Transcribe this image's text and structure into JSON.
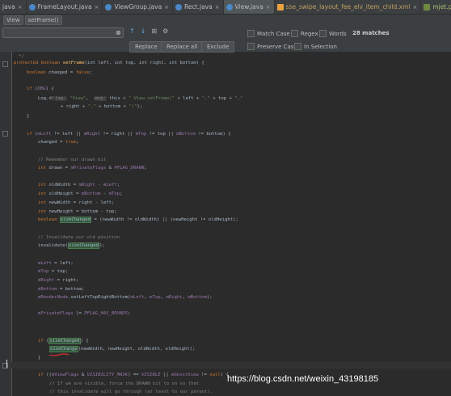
{
  "tabs": [
    {
      "label": "java",
      "icon": "java-file-icon",
      "active": false
    },
    {
      "label": "FrameLayout.java",
      "icon": "java-file-icon",
      "active": false
    },
    {
      "label": "ViewGroup.java",
      "icon": "java-file-icon",
      "active": false
    },
    {
      "label": "Rect.java",
      "icon": "java-file-icon",
      "active": false
    },
    {
      "label": "View.java",
      "icon": "java-file-icon",
      "active": true
    },
    {
      "label": "sse_swipe_layout_fee_elv_item_child.xml",
      "icon": "xml-file-icon",
      "active": false
    },
    {
      "label": "mjet.properties",
      "icon": "properties-file-icon",
      "active": false
    }
  ],
  "tab_close": "×",
  "breadcrumbs": [
    "View",
    "setFrame()"
  ],
  "find": {
    "input_value": "",
    "match_case": "Match Case",
    "regex": "Regex",
    "words": "Words",
    "matches": "28 matches",
    "preserve_case": "Preserve Case",
    "in_selection": "In Selection",
    "replace": "Replace",
    "replace_all": "Replace all",
    "exclude": "Exclude"
  },
  "code": {
    "l00": "*/",
    "l01_kw": "protected boolean ",
    "l01_mt": "setFrame",
    "l01_rest": "(int left, int top, int right, int bottom) {",
    "l02_kw": "boolean ",
    "l02_rest": "changed = ",
    "l02_kw2": "false",
    "l02_end": ";",
    "l04_kw": "if ",
    "l04_rest": "(",
    "l04_fd": "DBG",
    "l04_end": ") {",
    "l05_a": "Log.d(",
    "l05_tag": "tag:",
    "l05_s1": " \"View\"",
    "l05_c": ",  ",
    "l05_msg": "msg:",
    "l05_b": " this + ",
    "l05_s2": "\" View.setFrame(\"",
    "l05_e": " + left + ",
    "l05_s3": "\",\"",
    "l05_f": " + top + ",
    "l05_s4": "\",\"",
    "l06_a": "+ right + ",
    "l06_s": "\",\"",
    "l06_b": " + bottom + ",
    "l06_s2": "\")\"",
    "l06_c": ");",
    "l07": "}",
    "l09_kw": "if ",
    "l09_a": "(",
    "l09_f1": "mLeft",
    "l09_b": " != left || ",
    "l09_f2": "mRight",
    "l09_c": " != right || ",
    "l09_f3": "mTop",
    "l09_d": " != top || ",
    "l09_f4": "mBottom",
    "l09_e": " != bottom) {",
    "l10_a": "changed = ",
    "l10_kw": "true",
    "l10_b": ";",
    "l12": "// Remember our drawn bit",
    "l13_kw": "int ",
    "l13_a": "drawn = ",
    "l13_f": "mPrivateFlags",
    "l13_b": " & ",
    "l13_c": "PFLAG_DRAWN",
    "l13_d": ";",
    "l15_kw": "int ",
    "l15_a": "oldWidth = ",
    "l15_f1": "mRight",
    "l15_b": " - ",
    "l15_f2": "mLeft",
    "l15_c": ";",
    "l16_kw": "int ",
    "l16_a": "oldHeight = ",
    "l16_f1": "mBottom",
    "l16_b": " - ",
    "l16_f2": "mTop",
    "l16_c": ";",
    "l17_kw": "int ",
    "l17_a": "newWidth = right - left;",
    "l18_kw": "int ",
    "l18_a": "newHeight = bottom - top;",
    "l19_kw": "boolean ",
    "l19_hl": "sizeChanged",
    "l19_a": " = (newWidth != oldWidth) || (newHeight != oldHeight);",
    "l21": "// Invalidate our old position",
    "l22_a": "invalidate(",
    "l22_hl": "sizeChanged",
    "l22_b": ");",
    "l24_f": "mLeft",
    "l24_a": " = left;",
    "l25_f": "mTop",
    "l25_a": " = top;",
    "l26_f": "mRight",
    "l26_a": " = right;",
    "l27_f": "mBottom",
    "l27_a": " = bottom;",
    "l28_f": "mRenderNode",
    "l28_a": ".setLeftTopRightBottom(",
    "l28_f2": "mLeft",
    "l28_b": ", ",
    "l28_f3": "mTop",
    "l28_c": ", ",
    "l28_f4": "mRight",
    "l28_d": ", ",
    "l28_f5": "mBottom",
    "l28_e": ");",
    "l30_f": "mPrivateFlags",
    "l30_a": " |= ",
    "l30_c": "PFLAG_HAS_BOUNDS",
    "l30_b": ";",
    "l33_kw": "if ",
    "l33_a": "(",
    "l33_hl": "sizeChanged",
    "l33_b": ") {",
    "l34_hl": "sizeChange",
    "l34_a": "(newWidth, newHeight, oldWidth, oldHeight);",
    "l35": "}",
    "l37_kw": "if ",
    "l37_a": "((",
    "l37_f": "mViewFlags",
    "l37_b": " & ",
    "l37_c": "VISIBILITY_MASK",
    "l37_d": ") == ",
    "l37_e": "VISIBLE",
    "l37_g": " || ",
    "l37_f2": "mGhostView",
    "l37_h": " != ",
    "l37_kw2": "null",
    "l37_i": ") {",
    "l38": "// If we are visible, force the DRAWN bit to on so that",
    "l39": "// this invalidate will go through (at least to our parent)."
  },
  "watermark": "https://blog.csdn.net/weixin_43198185"
}
